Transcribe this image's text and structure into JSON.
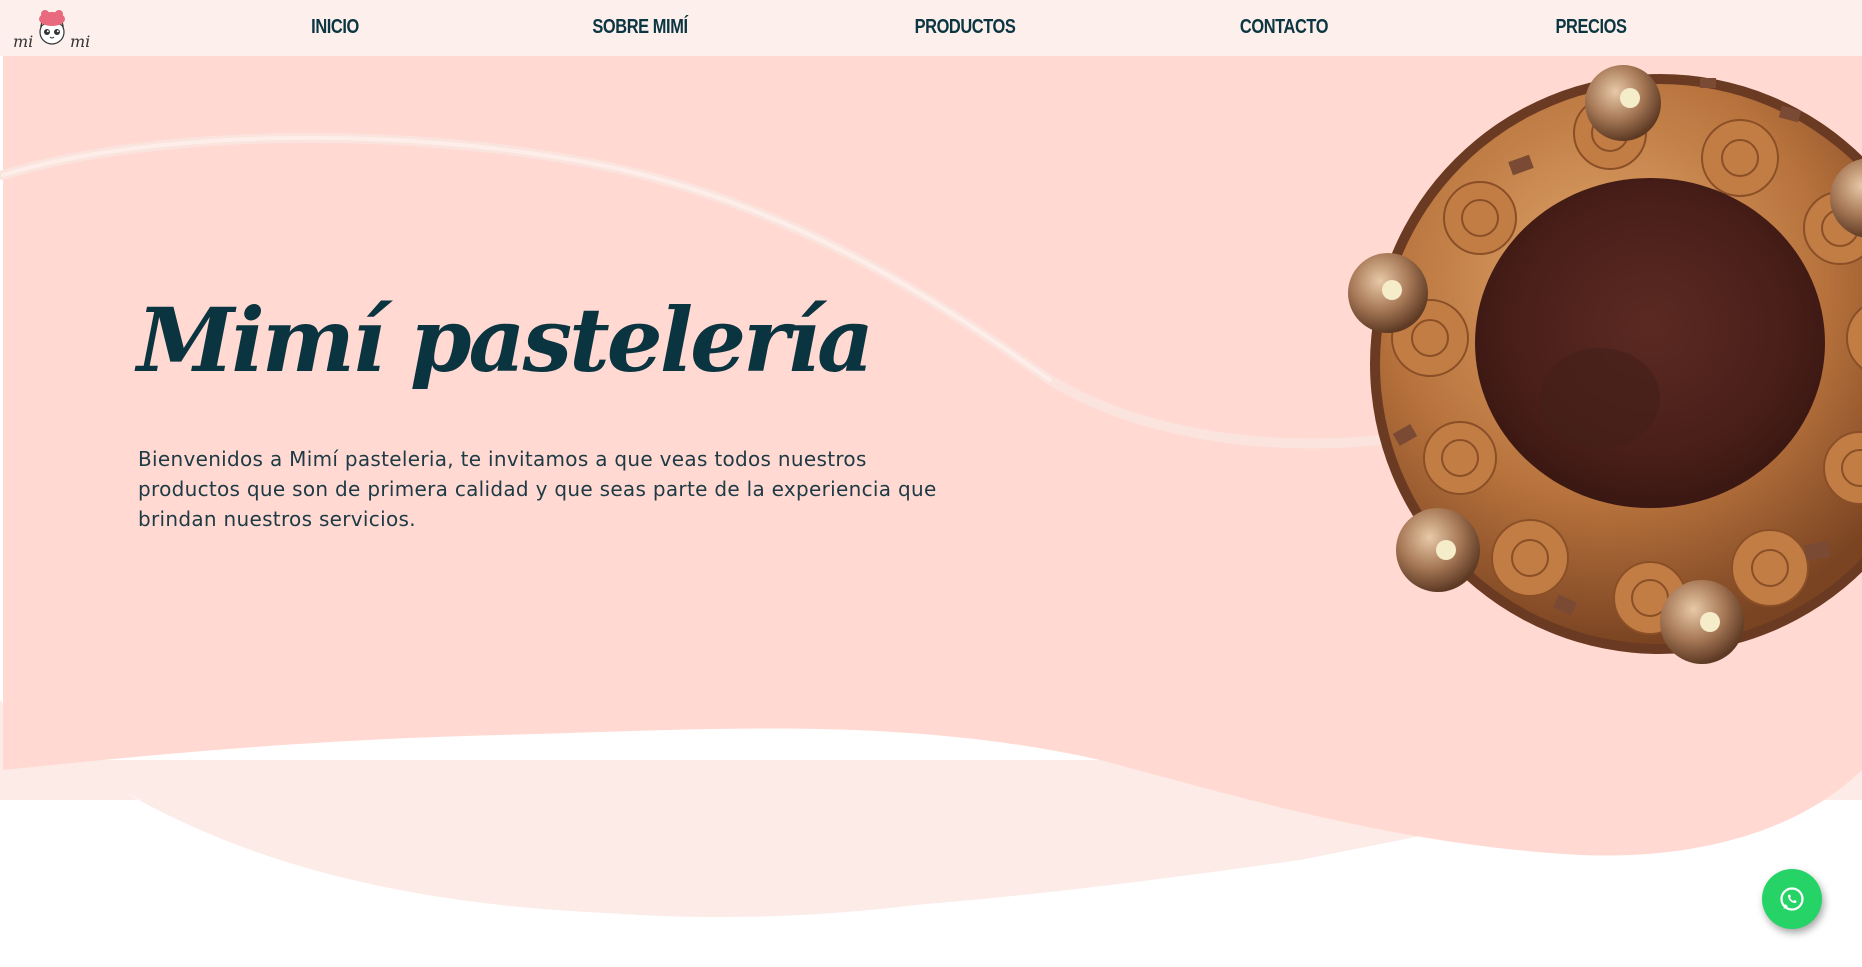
{
  "logo": {
    "text": "mimi"
  },
  "nav": {
    "items": [
      {
        "label": "INICIO"
      },
      {
        "label": "SOBRE MIMÍ"
      },
      {
        "label": "PRODUCTOS"
      },
      {
        "label": "CONTACTO"
      },
      {
        "label": "PRECIOS"
      }
    ]
  },
  "hero": {
    "title": "Mimí pastelería",
    "description": "Bienvenidos a Mimí pasteleria, te invitamos a que veas todos nuestros productos que son de primera calidad y que seas parte de la experiencia que brindan nuestros servicios."
  },
  "floating": {
    "icon": "whatsapp-icon"
  },
  "colors": {
    "nav_bg": "#fcefec",
    "hero_bg": "#ffd9d2",
    "wave_light": "#fcebe7",
    "text_dark": "#0a3440",
    "whatsapp": "#25d366"
  }
}
